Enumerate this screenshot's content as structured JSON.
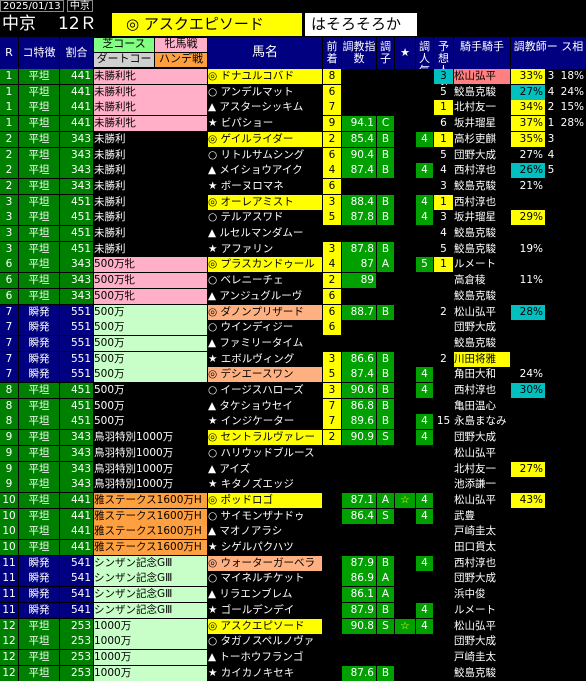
{
  "topbar": {
    "date": "2025/01/13",
    "venue": "中京"
  },
  "header": {
    "venue": "中京",
    "race": "12Ｒ",
    "horse": "◎ アスクエピソード",
    "comment": "はそろそろか"
  },
  "columns": {
    "r": "R",
    "track": "コ特徴",
    "pct": "割合",
    "class_top1": "芝コース",
    "class_top2": "ダートコー",
    "sexa": "牝馬戦",
    "sexb": "ハンデ戦",
    "name": "馬名",
    "fin": "前着",
    "cidx": "調教指数",
    "cond": "調子",
    "star": "★",
    "tone": "調人気",
    "pop": "予想人気",
    "jockey": "騎手騎手",
    "trainer": "調教師ー ス相",
    "trainer2": "ー ス相"
  },
  "rows": [
    {
      "r": "1",
      "track": "平坦",
      "pct": "441",
      "cls": "未勝利牝",
      "mark": "◎",
      "name": "ドナユルコバド",
      "fin": "8",
      "cidx": "",
      "cond": "",
      "star": "",
      "tone": "",
      "pop": "3",
      "jockey": "松山弘平",
      "t1": "33%",
      "t2": "3",
      "t3": "18%",
      "t4": "8",
      "pcol": "#00c0c0",
      "jcol": "#ff8080",
      "t1c": "#ffff00"
    },
    {
      "r": "1",
      "track": "平坦",
      "pct": "441",
      "cls": "未勝利牝",
      "mark": "○",
      "name": "アンデルマット",
      "fin": "6",
      "cidx": "",
      "cond": "",
      "star": "",
      "tone": "",
      "pop": "5",
      "jockey": "鮫島克駿",
      "t1": "27%",
      "t2": "4",
      "t3": "24%",
      "t4": "",
      "pcol": "",
      "jcol": "",
      "t1c": "#00c0c0"
    },
    {
      "r": "1",
      "track": "平坦",
      "pct": "441",
      "cls": "未勝利牝",
      "mark": "▲",
      "name": "アスターシッキム",
      "fin": "7",
      "cidx": "",
      "cond": "",
      "star": "",
      "tone": "",
      "pop": "1",
      "jockey": "北村友一",
      "t1": "34%",
      "t2": "2",
      "t3": "15%",
      "t4": "",
      "pcol": "#ffff00",
      "jcol": "",
      "t1c": "#ffff00"
    },
    {
      "r": "1",
      "track": "平坦",
      "pct": "441",
      "cls": "未勝利牝",
      "mark": "★",
      "name": "ビパショー",
      "fin": "9",
      "cidx": "94.1",
      "cond": "C",
      "star": "",
      "tone": "",
      "pop": "6",
      "jockey": "坂井瑠星",
      "t1": "37%",
      "t2": "1",
      "t3": "28%",
      "t4": "",
      "pcol": "",
      "jcol": "",
      "t1c": "#ffff00"
    },
    {
      "r": "2",
      "track": "平坦",
      "pct": "343",
      "cls": "未勝利",
      "mark": "◎",
      "name": "ゲイルライダー",
      "fin": "2",
      "cidx": "85.4",
      "cond": "B",
      "star": "",
      "tone": "4",
      "pop": "1",
      "jockey": "高杉吏麒",
      "t1": "35%",
      "t2": "3",
      "t3": "",
      "t4": "",
      "pcol": "#ffff00",
      "jcol": "",
      "t1c": "#ffff00"
    },
    {
      "r": "2",
      "track": "平坦",
      "pct": "343",
      "cls": "未勝利",
      "mark": "○",
      "name": "リトルサムシング",
      "fin": "6",
      "cidx": "90.4",
      "cond": "B",
      "star": "",
      "tone": "",
      "pop": "5",
      "jockey": "団野大成",
      "t1": "27%",
      "t2": "4",
      "t3": "",
      "t4": "",
      "pcol": "",
      "jcol": "",
      "t1c": ""
    },
    {
      "r": "2",
      "track": "平坦",
      "pct": "343",
      "cls": "未勝利",
      "mark": "▲",
      "name": "メイショウアイク",
      "fin": "4",
      "cidx": "87.4",
      "cond": "B",
      "star": "",
      "tone": "4",
      "pop": "4",
      "jockey": "西村淳也",
      "t1": "26%",
      "t2": "5",
      "t3": "",
      "t4": "",
      "pcol": "",
      "jcol": "",
      "t1c": "#00c0c0"
    },
    {
      "r": "2",
      "track": "平坦",
      "pct": "343",
      "cls": "未勝利",
      "mark": "★",
      "name": "ボーヌロマネ",
      "fin": "6",
      "cidx": "",
      "cond": "",
      "star": "",
      "tone": "",
      "pop": "3",
      "jockey": "鮫島克駿",
      "t1": "21%",
      "t2": "",
      "t3": "",
      "t4": "",
      "pcol": "",
      "jcol": "",
      "t1c": ""
    },
    {
      "r": "3",
      "track": "平坦",
      "pct": "451",
      "cls": "未勝利",
      "mark": "◎",
      "name": "オーレアミスト",
      "fin": "3",
      "cidx": "88.4",
      "cond": "B",
      "star": "",
      "tone": "4",
      "pop": "1",
      "jockey": "西村淳也",
      "t1": "",
      "t2": "",
      "t3": "",
      "t4": "",
      "pcol": "#ffff00",
      "jcol": "",
      "t1c": ""
    },
    {
      "r": "3",
      "track": "平坦",
      "pct": "451",
      "cls": "未勝利",
      "mark": "○",
      "name": "テルアスワド",
      "fin": "5",
      "cidx": "87.8",
      "cond": "B",
      "star": "",
      "tone": "4",
      "pop": "3",
      "jockey": "坂井瑠星",
      "t1": "29%",
      "t2": "",
      "t3": "",
      "t4": "",
      "pcol": "",
      "jcol": "",
      "t1c": "#ffff00"
    },
    {
      "r": "3",
      "track": "平坦",
      "pct": "451",
      "cls": "未勝利",
      "mark": "▲",
      "name": "ルセルマンダムー",
      "fin": "",
      "cidx": "",
      "cond": "",
      "star": "",
      "tone": "",
      "pop": "4",
      "jockey": "鮫島克駿",
      "t1": "",
      "t2": "",
      "t3": "",
      "t4": "",
      "pcol": "",
      "jcol": "",
      "t1c": ""
    },
    {
      "r": "3",
      "track": "平坦",
      "pct": "451",
      "cls": "未勝利",
      "mark": "★",
      "name": "アファリン",
      "fin": "3",
      "cidx": "87.8",
      "cond": "B",
      "star": "",
      "tone": "",
      "pop": "5",
      "jockey": "鮫島克駿",
      "t1": "19%",
      "t2": "",
      "t3": "",
      "t4": "",
      "pcol": "",
      "jcol": "",
      "t1c": ""
    },
    {
      "r": "6",
      "track": "平坦",
      "pct": "343",
      "cls": "500万牝",
      "mark": "◎",
      "name": "プラスカンドゥール",
      "fin": "4",
      "cidx": "87",
      "cond": "A",
      "star": "",
      "tone": "5",
      "pop": "1",
      "jockey": "ルメート",
      "t1": "",
      "t2": "",
      "t3": "",
      "t4": "",
      "pcol": "#ffff00",
      "jcol": "",
      "t1c": ""
    },
    {
      "r": "6",
      "track": "平坦",
      "pct": "343",
      "cls": "500万牝",
      "mark": "○",
      "name": "ベレニーチェ",
      "fin": "2",
      "cidx": "89",
      "cond": "",
      "star": "",
      "tone": "",
      "pop": "",
      "jockey": "高倉稜",
      "t1": "11%",
      "t2": "",
      "t3": "",
      "t4": "",
      "pcol": "",
      "jcol": "",
      "t1c": ""
    },
    {
      "r": "6",
      "track": "平坦",
      "pct": "343",
      "cls": "500万牝",
      "mark": "▲",
      "name": "アンジュグルーヴ",
      "fin": "6",
      "cidx": "",
      "cond": "",
      "star": "",
      "tone": "",
      "pop": "",
      "jockey": "鮫島克駿",
      "t1": "",
      "t2": "",
      "t3": "",
      "t4": "",
      "pcol": "",
      "jcol": "",
      "t1c": ""
    },
    {
      "r": "7",
      "track": "瞬発",
      "pct": "551",
      "cls": "500万",
      "mark": "◎",
      "name": "ダノンプリザード",
      "fin": "6",
      "cidx": "88.7",
      "cond": "B",
      "star": "",
      "tone": "",
      "pop": "2",
      "jockey": "松山弘平",
      "t1": "28%",
      "t2": "",
      "t3": "",
      "t4": "",
      "pcol": "",
      "jcol": "",
      "t1c": "#00c0c0"
    },
    {
      "r": "7",
      "track": "瞬発",
      "pct": "551",
      "cls": "500万",
      "mark": "○",
      "name": "ウインディジー",
      "fin": "6",
      "cidx": "",
      "cond": "",
      "star": "",
      "tone": "",
      "pop": "",
      "jockey": "団野大成",
      "t1": "",
      "t2": "",
      "t3": "",
      "t4": "",
      "pcol": "",
      "jcol": "",
      "t1c": ""
    },
    {
      "r": "7",
      "track": "瞬発",
      "pct": "551",
      "cls": "500万",
      "mark": "▲",
      "name": "ファミリータイム",
      "fin": "",
      "cidx": "",
      "cond": "",
      "star": "",
      "tone": "",
      "pop": "",
      "jockey": "鮫島克駿",
      "t1": "",
      "t2": "",
      "t3": "",
      "t4": "",
      "pcol": "",
      "jcol": "",
      "t1c": ""
    },
    {
      "r": "7",
      "track": "瞬発",
      "pct": "551",
      "cls": "500万",
      "mark": "★",
      "name": "エボルヴィング",
      "fin": "3",
      "cidx": "86.6",
      "cond": "B",
      "star": "",
      "tone": "",
      "pop": "2",
      "jockey": "川田将雅",
      "t1": "",
      "t2": "",
      "t3": "",
      "t4": "",
      "pcol": "",
      "jcol": "#ffff00",
      "t1c": ""
    },
    {
      "r": "7",
      "track": "瞬発",
      "pct": "551",
      "cls": "500万",
      "mark": "◎",
      "name": "デシエースワン",
      "fin": "5",
      "cidx": "87.4",
      "cond": "B",
      "star": "",
      "tone": "4",
      "pop": "",
      "jockey": "角田大和",
      "t1": "24%",
      "t2": "",
      "t3": "",
      "t4": "",
      "pcol": "",
      "jcol": "",
      "t1c": ""
    },
    {
      "r": "8",
      "track": "平坦",
      "pct": "451",
      "cls": "500万",
      "mark": "○",
      "name": "イージスハローズ",
      "fin": "3",
      "cidx": "90.6",
      "cond": "B",
      "star": "",
      "tone": "4",
      "pop": "",
      "jockey": "西村淳也",
      "t1": "30%",
      "t2": "",
      "t3": "",
      "t4": "",
      "pcol": "",
      "jcol": "",
      "t1c": "#00c0c0"
    },
    {
      "r": "8",
      "track": "平坦",
      "pct": "451",
      "cls": "500万",
      "mark": "▲",
      "name": "タケショウセイ",
      "fin": "7",
      "cidx": "86.8",
      "cond": "B",
      "star": "",
      "tone": "",
      "pop": "",
      "jockey": "亀田温心",
      "t1": "",
      "t2": "",
      "t3": "",
      "t4": "",
      "pcol": "",
      "jcol": "",
      "t1c": ""
    },
    {
      "r": "8",
      "track": "平坦",
      "pct": "451",
      "cls": "500万",
      "mark": "★",
      "name": "インジケーター",
      "fin": "7",
      "cidx": "89.6",
      "cond": "B",
      "star": "",
      "tone": "4",
      "pop": "15",
      "jockey": "永島まなみ",
      "t1": "",
      "t2": "",
      "t3": "",
      "t4": "",
      "pcol": "",
      "jcol": "",
      "t1c": ""
    },
    {
      "r": "9",
      "track": "平坦",
      "pct": "343",
      "cls": "鳥羽特別1000万",
      "mark": "◎",
      "name": "セントラルヴァレー",
      "fin": "2",
      "cidx": "90.9",
      "cond": "S",
      "star": "",
      "tone": "4",
      "pop": "",
      "jockey": "団野大成",
      "t1": "",
      "t2": "",
      "t3": "",
      "t4": "",
      "pcol": "",
      "jcol": "",
      "t1c": ""
    },
    {
      "r": "9",
      "track": "平坦",
      "pct": "343",
      "cls": "鳥羽特別1000万",
      "mark": "○",
      "name": "ハリウッドブルース",
      "fin": "",
      "cidx": "",
      "cond": "",
      "star": "",
      "tone": "",
      "pop": "",
      "jockey": "松山弘平",
      "t1": "",
      "t2": "",
      "t3": "",
      "t4": "",
      "pcol": "",
      "jcol": "",
      "t1c": ""
    },
    {
      "r": "9",
      "track": "平坦",
      "pct": "343",
      "cls": "鳥羽特別1000万",
      "mark": "▲",
      "name": "アイズ",
      "fin": "",
      "cidx": "",
      "cond": "",
      "star": "",
      "tone": "",
      "pop": "",
      "jockey": "北村友一",
      "t1": "27%",
      "t2": "",
      "t3": "",
      "t4": "",
      "pcol": "",
      "jcol": "",
      "t1c": "#ffff00"
    },
    {
      "r": "9",
      "track": "平坦",
      "pct": "343",
      "cls": "鳥羽特別1000万",
      "mark": "★",
      "name": "キタノズエッジ",
      "fin": "",
      "cidx": "",
      "cond": "",
      "star": "",
      "tone": "",
      "pop": "",
      "jockey": "池添謙一",
      "t1": "",
      "t2": "",
      "t3": "",
      "t4": "",
      "pcol": "",
      "jcol": "",
      "t1c": ""
    },
    {
      "r": "10",
      "track": "平坦",
      "pct": "441",
      "cls": "雅ステークス1600万H",
      "mark": "◎",
      "name": "ポッドロゴ",
      "fin": "",
      "cidx": "87.1",
      "cond": "A",
      "star": "☆",
      "tone": "4",
      "pop": "",
      "jockey": "松山弘平",
      "t1": "43%",
      "t2": "",
      "t3": "",
      "t4": "",
      "pcol": "",
      "jcol": "",
      "t1c": "#ffff00"
    },
    {
      "r": "10",
      "track": "平坦",
      "pct": "441",
      "cls": "雅ステークス1600万H",
      "mark": "○",
      "name": "サイモンザナドゥ",
      "fin": "",
      "cidx": "86.4",
      "cond": "S",
      "star": "",
      "tone": "4",
      "pop": "",
      "jockey": "武豊",
      "t1": "",
      "t2": "",
      "t3": "",
      "t4": "",
      "pcol": "",
      "jcol": "",
      "t1c": ""
    },
    {
      "r": "10",
      "track": "平坦",
      "pct": "441",
      "cls": "雅ステークス1600万H",
      "mark": "▲",
      "name": "マオノアラシ",
      "fin": "",
      "cidx": "",
      "cond": "",
      "star": "",
      "tone": "",
      "pop": "",
      "jockey": "戸崎圭太",
      "t1": "",
      "t2": "",
      "t3": "",
      "t4": "",
      "pcol": "",
      "jcol": "",
      "t1c": ""
    },
    {
      "r": "10",
      "track": "平坦",
      "pct": "441",
      "cls": "雅ステークス1600万H",
      "mark": "★",
      "name": "シゲルパクハツ",
      "fin": "",
      "cidx": "",
      "cond": "",
      "star": "",
      "tone": "",
      "pop": "",
      "jockey": "田口貫太",
      "t1": "",
      "t2": "",
      "t3": "",
      "t4": "",
      "pcol": "",
      "jcol": "",
      "t1c": ""
    },
    {
      "r": "11",
      "track": "瞬発",
      "pct": "541",
      "cls": "シンザン記念GⅢ",
      "mark": "◎",
      "name": "ウォーターガーベラ",
      "fin": "",
      "cidx": "87.9",
      "cond": "B",
      "star": "",
      "tone": "4",
      "pop": "",
      "jockey": "西村淳也",
      "t1": "",
      "t2": "",
      "t3": "",
      "t4": "",
      "pcol": "",
      "jcol": "",
      "t1c": ""
    },
    {
      "r": "11",
      "track": "瞬発",
      "pct": "541",
      "cls": "シンザン記念GⅢ",
      "mark": "○",
      "name": "マイネルチケット",
      "fin": "",
      "cidx": "86.9",
      "cond": "A",
      "star": "",
      "tone": "",
      "pop": "",
      "jockey": "団野大成",
      "t1": "",
      "t2": "",
      "t3": "",
      "t4": "",
      "pcol": "",
      "jcol": "",
      "t1c": ""
    },
    {
      "r": "11",
      "track": "瞬発",
      "pct": "541",
      "cls": "シンザン記念GⅢ",
      "mark": "▲",
      "name": "リラエンブレム",
      "fin": "",
      "cidx": "86.1",
      "cond": "A",
      "star": "",
      "tone": "",
      "pop": "",
      "jockey": "浜中俊",
      "t1": "",
      "t2": "",
      "t3": "",
      "t4": "",
      "pcol": "",
      "jcol": "",
      "t1c": ""
    },
    {
      "r": "11",
      "track": "瞬発",
      "pct": "541",
      "cls": "シンザン記念GⅢ",
      "mark": "★",
      "name": "ゴールデンデイ",
      "fin": "",
      "cidx": "87.9",
      "cond": "B",
      "star": "",
      "tone": "4",
      "pop": "",
      "jockey": "ルメート",
      "t1": "",
      "t2": "",
      "t3": "",
      "t4": "",
      "pcol": "",
      "jcol": "",
      "t1c": ""
    },
    {
      "r": "12",
      "track": "平坦",
      "pct": "253",
      "cls": "1000万",
      "mark": "◎",
      "name": "アスクエピソード",
      "fin": "",
      "cidx": "90.8",
      "cond": "S",
      "star": "☆",
      "tone": "4",
      "pop": "",
      "jockey": "松山弘平",
      "t1": "",
      "t2": "",
      "t3": "",
      "t4": "",
      "pcol": "",
      "jcol": "",
      "t1c": ""
    },
    {
      "r": "12",
      "track": "平坦",
      "pct": "253",
      "cls": "1000万",
      "mark": "○",
      "name": "タガノスペルノヴァ",
      "fin": "",
      "cidx": "",
      "cond": "",
      "star": "",
      "tone": "",
      "pop": "",
      "jockey": "団野大成",
      "t1": "",
      "t2": "",
      "t3": "",
      "t4": "",
      "pcol": "",
      "jcol": "",
      "t1c": ""
    },
    {
      "r": "12",
      "track": "平坦",
      "pct": "253",
      "cls": "1000万",
      "mark": "▲",
      "name": "トーホウフランゴ",
      "fin": "",
      "cidx": "",
      "cond": "",
      "star": "",
      "tone": "",
      "pop": "",
      "jockey": "戸崎圭太",
      "t1": "",
      "t2": "",
      "t3": "",
      "t4": "",
      "pcol": "",
      "jcol": "",
      "t1c": ""
    },
    {
      "r": "12",
      "track": "平坦",
      "pct": "253",
      "cls": "1000万",
      "mark": "★",
      "name": "カイカノキセキ",
      "fin": "",
      "cidx": "87.6",
      "cond": "B",
      "star": "",
      "tone": "",
      "pop": "",
      "jockey": "鮫島克駿",
      "t1": "",
      "t2": "",
      "t3": "",
      "t4": "",
      "pcol": "",
      "jcol": "",
      "t1c": ""
    }
  ],
  "colors": {
    "track_heijin": "#008000",
    "track_shunpatsu": "#000080",
    "blank": "#00a000"
  }
}
